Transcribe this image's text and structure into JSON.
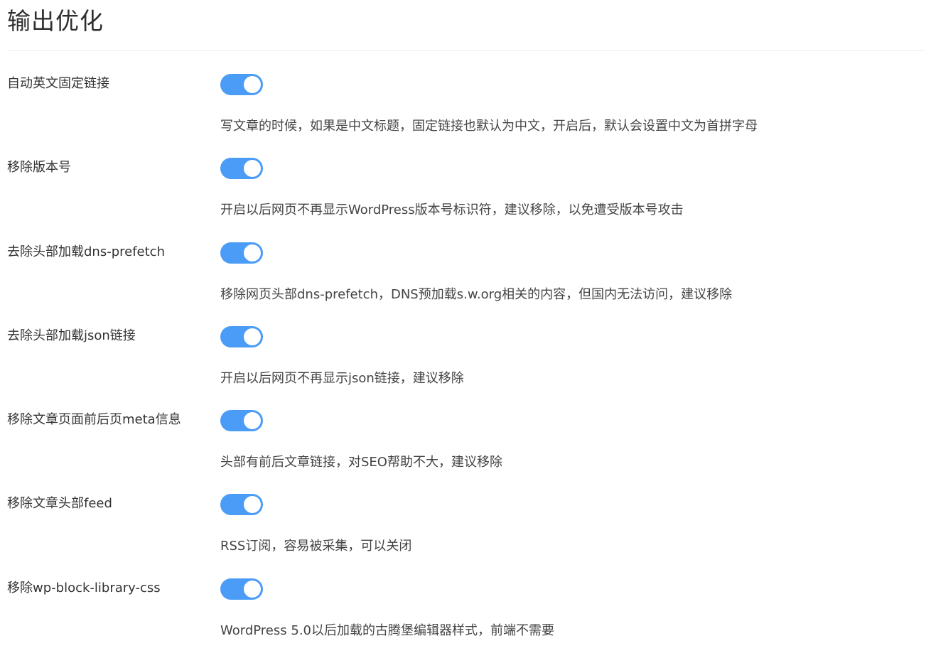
{
  "page": {
    "title": "输出优化"
  },
  "colors": {
    "toggle_on": "#4a9cf6",
    "knob": "#ffffff",
    "divider": "#ececec",
    "text": "#333333"
  },
  "settings": [
    {
      "label": "自动英文固定链接",
      "enabled": true,
      "description": "写文章的时候，如果是中文标题，固定链接也默认为中文，开启后，默认会设置中文为首拼字母"
    },
    {
      "label": "移除版本号",
      "enabled": true,
      "description": "开启以后网页不再显示WordPress版本号标识符，建议移除，以免遭受版本号攻击"
    },
    {
      "label": "去除头部加载dns-prefetch",
      "enabled": true,
      "description": "移除网页头部dns-prefetch，DNS预加载s.w.org相关的内容，但国内无法访问，建议移除"
    },
    {
      "label": "去除头部加载json链接",
      "enabled": true,
      "description": "开启以后网页不再显示json链接，建议移除"
    },
    {
      "label": "移除文章页面前后页meta信息",
      "enabled": true,
      "description": "头部有前后文章链接，对SEO帮助不大，建议移除"
    },
    {
      "label": "移除文章头部feed",
      "enabled": true,
      "description": "RSS订阅，容易被采集，可以关闭"
    },
    {
      "label": "移除wp-block-library-css",
      "enabled": true,
      "description": "WordPress 5.0以后加载的古腾堡编辑器样式，前端不需要"
    }
  ]
}
